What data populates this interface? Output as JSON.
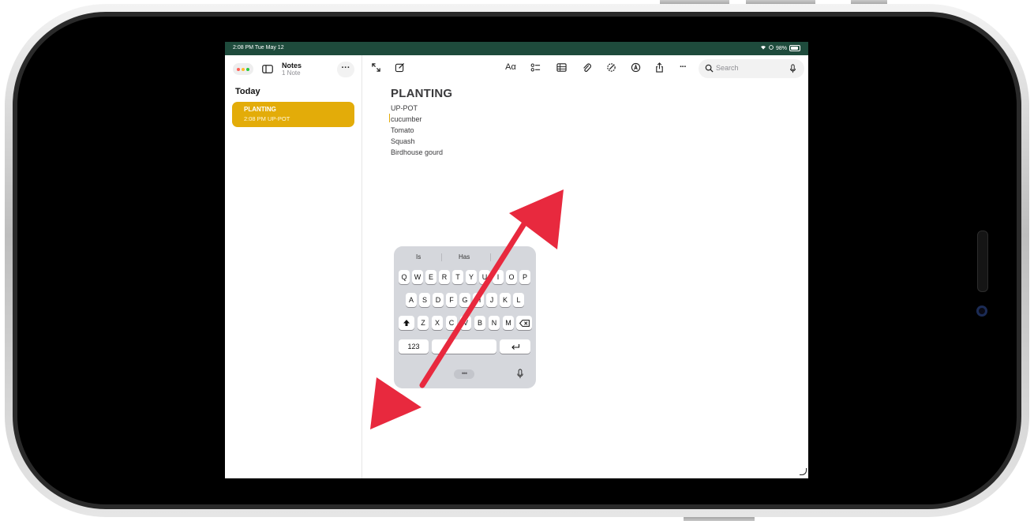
{
  "status_bar": {
    "time": "2:08 PM  Tue May 12",
    "battery": "98%"
  },
  "sidebar": {
    "folder_title": "Notes",
    "note_count": "1 Note",
    "section": "Today",
    "notes": [
      {
        "title": "PLANTING",
        "meta": "2:08 PM  UP-POT"
      }
    ]
  },
  "toolbar": {
    "icons": [
      "expand-icon",
      "compose-icon",
      "format-icon",
      "checklist-icon",
      "table-icon",
      "attachment-icon",
      "markup-icon",
      "pen-icon",
      "share-icon",
      "more-icon"
    ],
    "format_label": "Aα",
    "search_placeholder": "Search"
  },
  "note": {
    "title": "PLANTING",
    "lines": [
      "UP-POT",
      "cucumber",
      "Tomato",
      "Squash",
      "Birdhouse gourd"
    ]
  },
  "keyboard": {
    "suggestions": [
      "Is",
      "Has"
    ],
    "row1": [
      "Q",
      "W",
      "E",
      "R",
      "T",
      "Y",
      "U",
      "I",
      "O",
      "P"
    ],
    "row2": [
      "A",
      "S",
      "D",
      "F",
      "G",
      "H",
      "J",
      "K",
      "L"
    ],
    "row3": [
      "Z",
      "X",
      "C",
      "V",
      "B",
      "N",
      "M"
    ],
    "numbers_key": "123"
  },
  "annotation": {
    "arrow_color": "#e8293e"
  },
  "colors": {
    "accent": "#e3ac09",
    "status_bar": "#1e4b3c"
  }
}
